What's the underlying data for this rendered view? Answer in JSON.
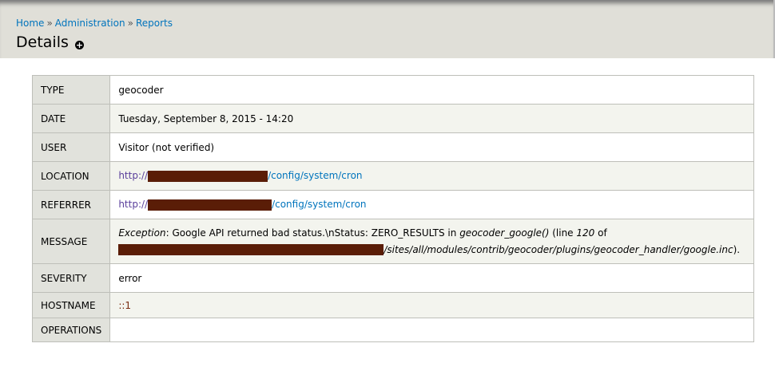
{
  "breadcrumb": [
    "Home",
    "Administration",
    "Reports"
  ],
  "breadcrumb_sep": "»",
  "page_title": "Details",
  "rows": [
    {
      "label": "TYPE",
      "value": "geocoder"
    },
    {
      "label": "DATE",
      "value": "Tuesday, September 8, 2015 - 14:20"
    },
    {
      "label": "USER",
      "value": "Visitor (not verified)"
    },
    {
      "label": "LOCATION",
      "prefix": "http://",
      "suffix": "/config/system/cron"
    },
    {
      "label": "REFERRER",
      "prefix": "http://",
      "suffix": "/config/system/cron"
    },
    {
      "label": "MESSAGE",
      "exception": "Exception",
      "msg1": ": Google API returned bad status.\\nStatus: ZERO_RESULTS in ",
      "func": "geocoder_google()",
      "msg2": " (line ",
      "line": "120",
      "msg3": " of",
      "path": "/sites/all/modules/contrib/geocoder/plugins/geocoder_handler/google.inc",
      "end": ")."
    },
    {
      "label": "SEVERITY",
      "value": "error"
    },
    {
      "label": "HOSTNAME",
      "value": "::1"
    },
    {
      "label": "OPERATIONS",
      "value": ""
    }
  ],
  "colors": {
    "link": "#0074bd",
    "redaction": "#5a1d07"
  }
}
